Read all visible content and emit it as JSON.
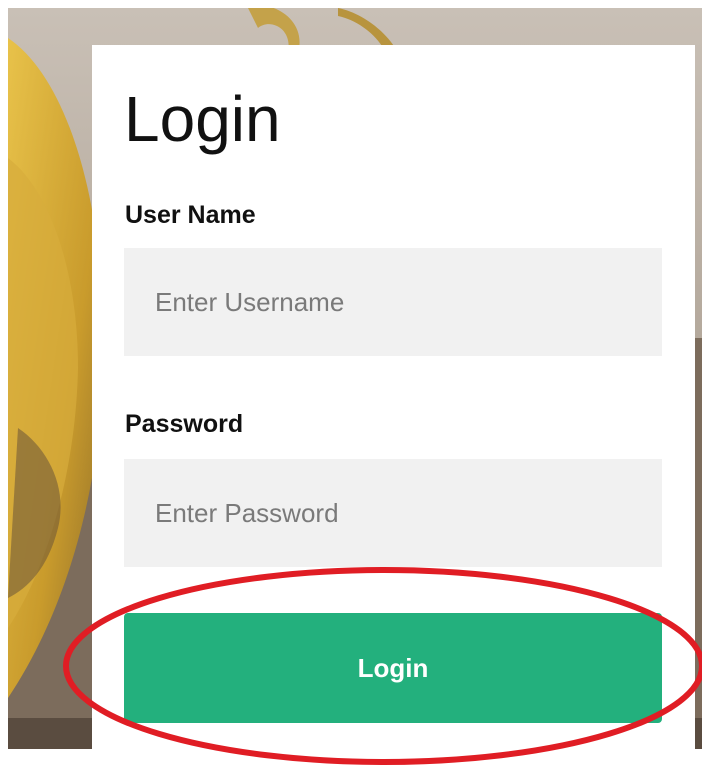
{
  "form": {
    "title": "Login",
    "username_label": "User Name",
    "username_placeholder": "Enter Username",
    "username_value": "",
    "password_label": "Password",
    "password_placeholder": "Enter Password",
    "password_value": "",
    "submit_label": "Login"
  },
  "colors": {
    "button_background": "#23b07d",
    "input_background": "#f1f1f1",
    "highlight_ellipse": "#e01d24"
  }
}
